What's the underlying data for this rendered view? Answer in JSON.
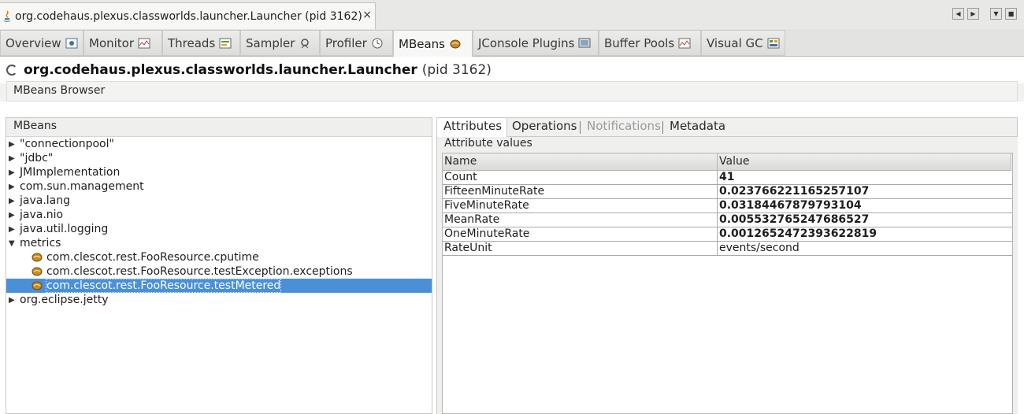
{
  "window": {
    "doc_tab_title": "org.codehaus.plexus.classworlds.launcher.Launcher (pid 3162)",
    "close_glyph": "×",
    "nav_buttons": [
      "◀",
      "▶",
      "▼",
      "■"
    ]
  },
  "view_tabs": [
    {
      "label": "Overview",
      "icon": "overview-icon"
    },
    {
      "label": "Monitor",
      "icon": "monitor-chart-icon"
    },
    {
      "label": "Threads",
      "icon": "threads-icon"
    },
    {
      "label": "Sampler",
      "icon": "sampler-icon"
    },
    {
      "label": "Profiler",
      "icon": "profiler-clock-icon"
    },
    {
      "label": "MBeans",
      "icon": "mbeans-icon",
      "active": true
    },
    {
      "label": "JConsole Plugins",
      "icon": "jconsole-plugins-icon"
    },
    {
      "label": "Buffer Pools",
      "icon": "buffer-pools-chart-icon"
    },
    {
      "label": "Visual GC",
      "icon": "visual-gc-icon"
    }
  ],
  "process": {
    "name": "org.codehaus.plexus.classworlds.launcher.Launcher",
    "pid": "(pid 3162)"
  },
  "browser_label": "MBeans Browser",
  "tree": {
    "header": "MBeans",
    "nodes": [
      {
        "label": "\"connectionpool\"",
        "expanded": false
      },
      {
        "label": "\"jdbc\"",
        "expanded": false
      },
      {
        "label": "JMImplementation",
        "expanded": false
      },
      {
        "label": "com.sun.management",
        "expanded": false
      },
      {
        "label": "java.lang",
        "expanded": false
      },
      {
        "label": "java.nio",
        "expanded": false
      },
      {
        "label": "java.util.logging",
        "expanded": false
      },
      {
        "label": "metrics",
        "expanded": true
      },
      {
        "label": "com.clescot.rest.FooResource.cputime",
        "child": true
      },
      {
        "label": "com.clescot.rest.FooResource.testException.exceptions",
        "child": true
      },
      {
        "label": "com.clescot.rest.FooResource.testMetered",
        "child": true,
        "selected": true
      },
      {
        "label": "org.eclipse.jetty",
        "expanded": false
      }
    ]
  },
  "detail_tabs": [
    {
      "label": "Attributes",
      "active": true
    },
    {
      "label": "Operations"
    },
    {
      "label": "Notifications",
      "disabled": true
    },
    {
      "label": "Metadata"
    }
  ],
  "attributes": {
    "caption": "Attribute values",
    "columns": [
      "Name",
      "Value"
    ],
    "rows": [
      {
        "name": "Count",
        "value": "41",
        "bold": true
      },
      {
        "name": "FifteenMinuteRate",
        "value": "0.023766221165257107",
        "bold": true
      },
      {
        "name": "FiveMinuteRate",
        "value": "0.03184467879793104",
        "bold": true
      },
      {
        "name": "MeanRate",
        "value": "0.005532765247686527",
        "bold": true
      },
      {
        "name": "OneMinuteRate",
        "value": "0.0012652472393622819",
        "bold": true
      },
      {
        "name": "RateUnit",
        "value": "events/second",
        "bold": false
      }
    ]
  },
  "colors": {
    "selection": "#4a90d9",
    "bean_icon": "#d08a1e"
  }
}
